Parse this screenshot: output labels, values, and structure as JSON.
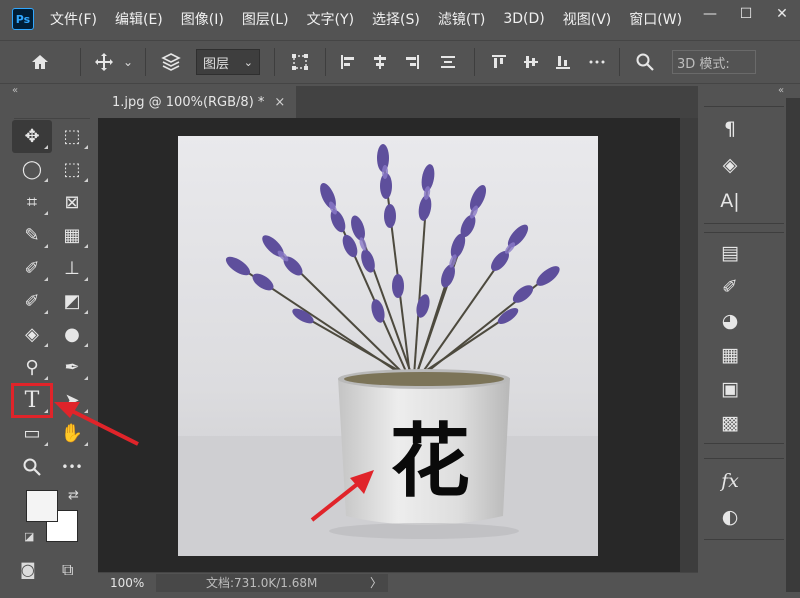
{
  "app": {
    "logo_text": "Ps",
    "menu": [
      "文件(F)",
      "编辑(E)",
      "图像(I)",
      "图层(L)",
      "文字(Y)",
      "选择(S)",
      "滤镜(T)",
      "3D(D)",
      "视图(V)",
      "窗口(W)"
    ],
    "window_controls": {
      "minimize": "—",
      "maximize": "☐",
      "close": "✕"
    }
  },
  "options_bar": {
    "layer_select": "图层",
    "mode_input": "3D 模式:"
  },
  "collapse_glyph": "«",
  "toolbar": {
    "tools": [
      {
        "name": "move-tool",
        "glyph": "✥"
      },
      {
        "name": "marquee-tool",
        "glyph": "⬚"
      },
      {
        "name": "lasso-tool",
        "glyph": "◯"
      },
      {
        "name": "object-select-tool",
        "glyph": "⬚"
      },
      {
        "name": "crop-tool",
        "glyph": "⌗"
      },
      {
        "name": "frame-tool",
        "glyph": "⊠"
      },
      {
        "name": "eyedropper-tool",
        "glyph": "✎"
      },
      {
        "name": "healing-brush-tool",
        "glyph": "▦"
      },
      {
        "name": "brush-tool",
        "glyph": "✐"
      },
      {
        "name": "clone-stamp-tool",
        "glyph": "⊥"
      },
      {
        "name": "history-brush-tool",
        "glyph": "✐"
      },
      {
        "name": "eraser-tool",
        "glyph": "◩"
      },
      {
        "name": "paint-bucket-tool",
        "glyph": "◈"
      },
      {
        "name": "blur-tool",
        "glyph": "●"
      },
      {
        "name": "dodge-tool",
        "glyph": "⚲"
      },
      {
        "name": "pen-tool",
        "glyph": "✒"
      },
      {
        "name": "type-tool",
        "glyph": "T"
      },
      {
        "name": "path-select-tool",
        "glyph": "➤"
      },
      {
        "name": "rectangle-tool",
        "glyph": "▭"
      },
      {
        "name": "hand-tool",
        "glyph": "✋"
      },
      {
        "name": "zoom-tool",
        "glyph": "🔍"
      },
      {
        "name": "more-tools",
        "glyph": "•••"
      }
    ],
    "swap_glyph": "⇄",
    "default_glyph": "◪",
    "quickmask_glyph": "◙",
    "screenmode_glyph": "⧉"
  },
  "document": {
    "tab_title": "1.jpg @ 100%(RGB/8) *",
    "tab_close": "×",
    "zoom": "100%",
    "doc_size": "文档:731.0K/1.68M",
    "doc_size_chevron": "〉",
    "type_layer_text": "花"
  },
  "right_panels": {
    "paragraph_glyph": "¶",
    "layers_glyph": "◈",
    "character_glyph": "A|",
    "history_glyph": "▤",
    "brush_glyph": "✐",
    "color_glyph": "◕",
    "swatches_glyph": "▦",
    "gradient_glyph": "▣",
    "patterns_glyph": "▩",
    "fx_glyph": "fx",
    "adjust_glyph": "◐"
  },
  "colors": {
    "highlight": "#e0242a",
    "ui_bg": "#535353",
    "canvas_bg": "#282828"
  }
}
